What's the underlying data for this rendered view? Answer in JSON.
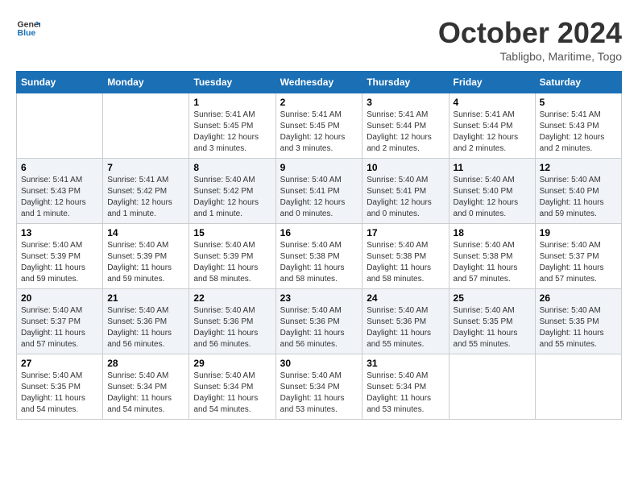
{
  "header": {
    "logo_line1": "General",
    "logo_line2": "Blue",
    "month_title": "October 2024",
    "subtitle": "Tabligbo, Maritime, Togo"
  },
  "days_of_week": [
    "Sunday",
    "Monday",
    "Tuesday",
    "Wednesday",
    "Thursday",
    "Friday",
    "Saturday"
  ],
  "weeks": [
    [
      {
        "day": "",
        "info": ""
      },
      {
        "day": "",
        "info": ""
      },
      {
        "day": "1",
        "info": "Sunrise: 5:41 AM\nSunset: 5:45 PM\nDaylight: 12 hours\nand 3 minutes."
      },
      {
        "day": "2",
        "info": "Sunrise: 5:41 AM\nSunset: 5:45 PM\nDaylight: 12 hours\nand 3 minutes."
      },
      {
        "day": "3",
        "info": "Sunrise: 5:41 AM\nSunset: 5:44 PM\nDaylight: 12 hours\nand 2 minutes."
      },
      {
        "day": "4",
        "info": "Sunrise: 5:41 AM\nSunset: 5:44 PM\nDaylight: 12 hours\nand 2 minutes."
      },
      {
        "day": "5",
        "info": "Sunrise: 5:41 AM\nSunset: 5:43 PM\nDaylight: 12 hours\nand 2 minutes."
      }
    ],
    [
      {
        "day": "6",
        "info": "Sunrise: 5:41 AM\nSunset: 5:43 PM\nDaylight: 12 hours\nand 1 minute."
      },
      {
        "day": "7",
        "info": "Sunrise: 5:41 AM\nSunset: 5:42 PM\nDaylight: 12 hours\nand 1 minute."
      },
      {
        "day": "8",
        "info": "Sunrise: 5:40 AM\nSunset: 5:42 PM\nDaylight: 12 hours\nand 1 minute."
      },
      {
        "day": "9",
        "info": "Sunrise: 5:40 AM\nSunset: 5:41 PM\nDaylight: 12 hours\nand 0 minutes."
      },
      {
        "day": "10",
        "info": "Sunrise: 5:40 AM\nSunset: 5:41 PM\nDaylight: 12 hours\nand 0 minutes."
      },
      {
        "day": "11",
        "info": "Sunrise: 5:40 AM\nSunset: 5:40 PM\nDaylight: 12 hours\nand 0 minutes."
      },
      {
        "day": "12",
        "info": "Sunrise: 5:40 AM\nSunset: 5:40 PM\nDaylight: 11 hours\nand 59 minutes."
      }
    ],
    [
      {
        "day": "13",
        "info": "Sunrise: 5:40 AM\nSunset: 5:39 PM\nDaylight: 11 hours\nand 59 minutes."
      },
      {
        "day": "14",
        "info": "Sunrise: 5:40 AM\nSunset: 5:39 PM\nDaylight: 11 hours\nand 59 minutes."
      },
      {
        "day": "15",
        "info": "Sunrise: 5:40 AM\nSunset: 5:39 PM\nDaylight: 11 hours\nand 58 minutes."
      },
      {
        "day": "16",
        "info": "Sunrise: 5:40 AM\nSunset: 5:38 PM\nDaylight: 11 hours\nand 58 minutes."
      },
      {
        "day": "17",
        "info": "Sunrise: 5:40 AM\nSunset: 5:38 PM\nDaylight: 11 hours\nand 58 minutes."
      },
      {
        "day": "18",
        "info": "Sunrise: 5:40 AM\nSunset: 5:38 PM\nDaylight: 11 hours\nand 57 minutes."
      },
      {
        "day": "19",
        "info": "Sunrise: 5:40 AM\nSunset: 5:37 PM\nDaylight: 11 hours\nand 57 minutes."
      }
    ],
    [
      {
        "day": "20",
        "info": "Sunrise: 5:40 AM\nSunset: 5:37 PM\nDaylight: 11 hours\nand 57 minutes."
      },
      {
        "day": "21",
        "info": "Sunrise: 5:40 AM\nSunset: 5:36 PM\nDaylight: 11 hours\nand 56 minutes."
      },
      {
        "day": "22",
        "info": "Sunrise: 5:40 AM\nSunset: 5:36 PM\nDaylight: 11 hours\nand 56 minutes."
      },
      {
        "day": "23",
        "info": "Sunrise: 5:40 AM\nSunset: 5:36 PM\nDaylight: 11 hours\nand 56 minutes."
      },
      {
        "day": "24",
        "info": "Sunrise: 5:40 AM\nSunset: 5:36 PM\nDaylight: 11 hours\nand 55 minutes."
      },
      {
        "day": "25",
        "info": "Sunrise: 5:40 AM\nSunset: 5:35 PM\nDaylight: 11 hours\nand 55 minutes."
      },
      {
        "day": "26",
        "info": "Sunrise: 5:40 AM\nSunset: 5:35 PM\nDaylight: 11 hours\nand 55 minutes."
      }
    ],
    [
      {
        "day": "27",
        "info": "Sunrise: 5:40 AM\nSunset: 5:35 PM\nDaylight: 11 hours\nand 54 minutes."
      },
      {
        "day": "28",
        "info": "Sunrise: 5:40 AM\nSunset: 5:34 PM\nDaylight: 11 hours\nand 54 minutes."
      },
      {
        "day": "29",
        "info": "Sunrise: 5:40 AM\nSunset: 5:34 PM\nDaylight: 11 hours\nand 54 minutes."
      },
      {
        "day": "30",
        "info": "Sunrise: 5:40 AM\nSunset: 5:34 PM\nDaylight: 11 hours\nand 53 minutes."
      },
      {
        "day": "31",
        "info": "Sunrise: 5:40 AM\nSunset: 5:34 PM\nDaylight: 11 hours\nand 53 minutes."
      },
      {
        "day": "",
        "info": ""
      },
      {
        "day": "",
        "info": ""
      }
    ]
  ]
}
